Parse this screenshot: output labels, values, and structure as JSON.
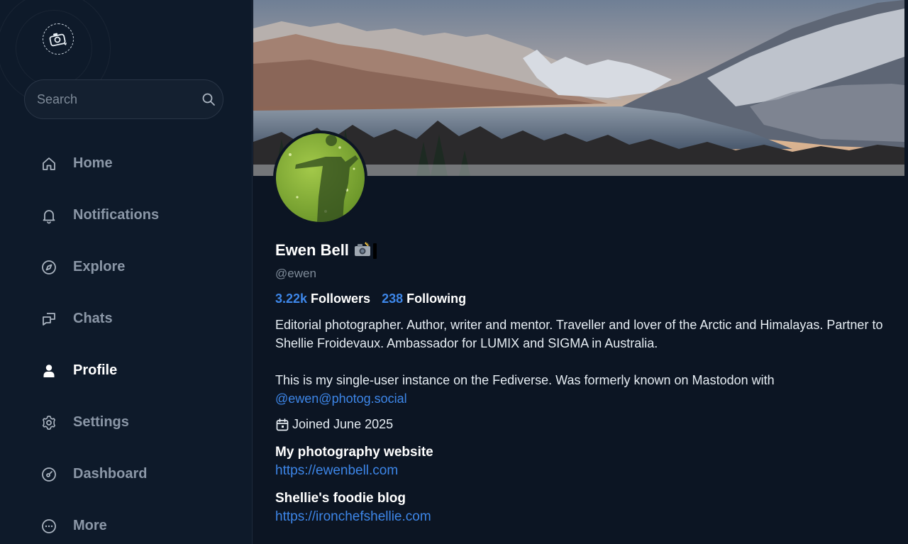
{
  "search": {
    "placeholder": "Search"
  },
  "nav": {
    "items": [
      {
        "label": "Home",
        "icon": "home-icon"
      },
      {
        "label": "Notifications",
        "icon": "bell-icon"
      },
      {
        "label": "Explore",
        "icon": "compass-icon"
      },
      {
        "label": "Chats",
        "icon": "chat-icon"
      },
      {
        "label": "Profile",
        "icon": "person-icon",
        "active": true
      },
      {
        "label": "Settings",
        "icon": "gear-icon"
      },
      {
        "label": "Dashboard",
        "icon": "gauge-icon"
      },
      {
        "label": "More",
        "icon": "more-icon"
      }
    ]
  },
  "profile": {
    "display_name": "Ewen Bell",
    "name_emoji": "camera-flash-icon",
    "handle": "@ewen",
    "followers_count": "3.22k",
    "followers_label": "Followers",
    "following_count": "238",
    "following_label": "Following",
    "bio_line1": "Editorial photographer. Author, writer and mentor. Traveller and lover of the Arctic and Himalayas. Partner to Shellie Froidevaux. Ambassador for LUMIX and SIGMA in Australia.",
    "bio_line2": "This is my single-user instance on the Fediverse. Was formerly known on Mastodon with",
    "bio_mention": "@ewen@photog.social",
    "joined": "Joined June 2025",
    "links": [
      {
        "title": "My photography website",
        "url": "https://ewenbell.com"
      },
      {
        "title": "Shellie's foodie blog",
        "url": "https://ironchefshellie.com"
      }
    ]
  },
  "colors": {
    "accent": "#3d86e8",
    "background": "#0c1523",
    "sidebar": "#0e1a2a"
  }
}
